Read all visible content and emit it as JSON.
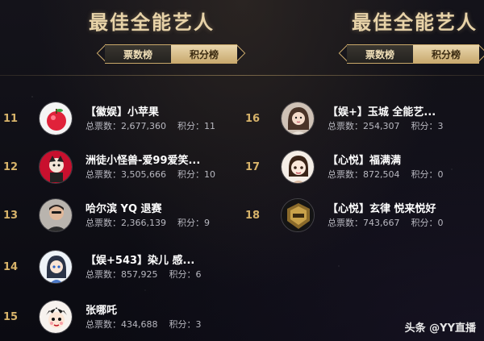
{
  "left_panel": {
    "title": "最佳全能艺人",
    "tabs": {
      "active": "票数榜",
      "inactive": "积分榜"
    },
    "entries": [
      {
        "rank": "11",
        "name": "【徽娱】小苹果",
        "votes_label": "总票数：",
        "votes": "2,677,360",
        "points_label": "积分：",
        "points": "11"
      },
      {
        "rank": "12",
        "name": "洲徒小怪兽-爱99爱笑...",
        "votes_label": "总票数：",
        "votes": "3,505,666",
        "points_label": "积分：",
        "points": "10"
      },
      {
        "rank": "13",
        "name": "哈尔滨 YQ 退赛",
        "votes_label": "总票数：",
        "votes": "2,366,139",
        "points_label": "积分：",
        "points": "9"
      },
      {
        "rank": "14",
        "name": "【娱+543】染儿 感...",
        "votes_label": "总票数：",
        "votes": "857,925",
        "points_label": "积分：",
        "points": "6"
      },
      {
        "rank": "15",
        "name": "张哪吒",
        "votes_label": "总票数：",
        "votes": "434,688",
        "points_label": "积分：",
        "points": "3"
      }
    ]
  },
  "right_panel": {
    "title": "最佳全能艺人",
    "tabs": {
      "active": "票数榜",
      "inactive": "积分榜"
    },
    "entries": [
      {
        "rank": "16",
        "name": "【娱+】玉城 全能艺...",
        "votes_label": "总票数：",
        "votes": "254,307",
        "points_label": "积分：",
        "points": "3"
      },
      {
        "rank": "17",
        "name": "【心悦】福满满",
        "votes_label": "总票数：",
        "votes": "872,504",
        "points_label": "积分：",
        "points": "0"
      },
      {
        "rank": "18",
        "name": "【心悦】玄律 悦来悦好",
        "votes_label": "总票数：",
        "votes": "743,667",
        "points_label": "积分：",
        "points": "0"
      }
    ]
  },
  "watermark": "头条 @YY直播",
  "colors": {
    "background": "#0b0b12",
    "gold": "#c9a86a",
    "title": "#e8d3a8",
    "rank": "#d7b36a"
  },
  "icons": {
    "avatar_11": "apple-avatar",
    "avatar_12": "cartoon-avatar",
    "avatar_13": "man-avatar",
    "avatar_14": "anime-girl-avatar",
    "avatar_15": "cartoon-kid-avatar",
    "avatar_16": "woman-avatar",
    "avatar_17": "cartoon-girl-avatar",
    "avatar_18": "gold-badge-avatar"
  }
}
